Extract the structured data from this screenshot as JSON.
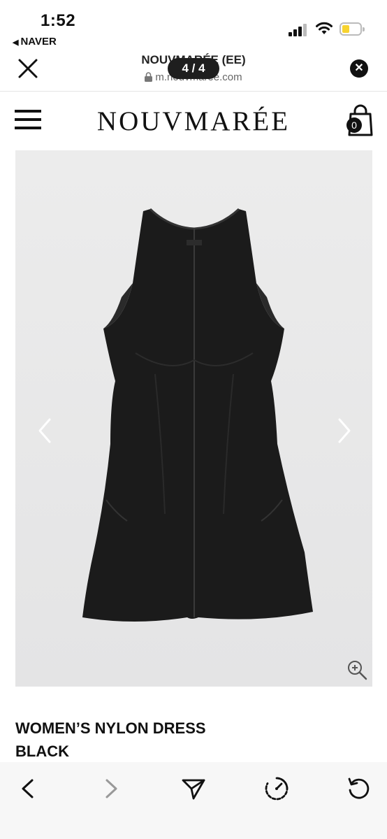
{
  "status_bar": {
    "time": "1:52",
    "back_app": "NAVER",
    "icons": [
      "cellular-signal-icon",
      "wifi-icon",
      "battery-low-icon"
    ],
    "battery_color": "#f7d32f"
  },
  "browser": {
    "title": "NOUVMARÉE (EE)",
    "url": "m.nouvmaree.com",
    "counter": "4 / 4",
    "dismiss_symbol": "✕"
  },
  "site": {
    "logo": "NOUVMARÉE",
    "cart_count": "0"
  },
  "product": {
    "name_line1": "WOMEN’S NYLON DRESS",
    "name_line2": "BLACK",
    "image_background": "#e9e9ea",
    "dress_color": "#1b1b1b"
  },
  "toolbar": {
    "icons": [
      "back-arrow-icon",
      "forward-arrow-icon",
      "share-icon",
      "timer-icon",
      "refresh-icon"
    ]
  }
}
